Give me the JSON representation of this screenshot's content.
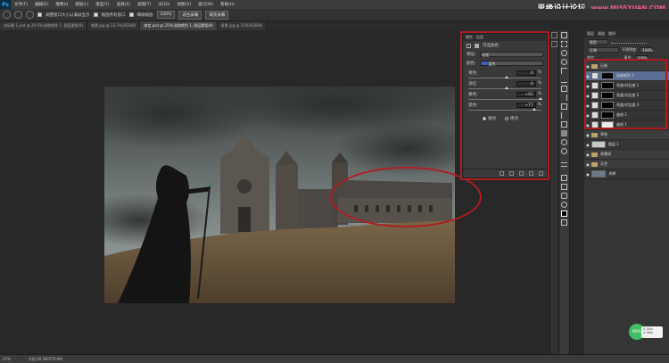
{
  "app": {
    "logo": "Ps",
    "accent": "#37a8f0"
  },
  "menubar": {
    "items": [
      "文件(F)",
      "编辑(E)",
      "图像(I)",
      "图层(L)",
      "类型(Y)",
      "选择(S)",
      "滤镜(T)",
      "3D(D)",
      "视图(V)",
      "窗口(W)",
      "帮助(H)"
    ]
  },
  "watermark": {
    "cn": "思缘设计论坛",
    "url": "www.MISSYUAN.COM"
  },
  "options": {
    "items": [
      "调整窗口大小以满屏显示",
      "缩放所有窗口",
      "细微缩放"
    ],
    "zoom_value": "100%",
    "fit_btn": "适合屏幕",
    "fill_btn": "填充屏幕"
  },
  "tabs": [
    "未标题-1.psd @ 29.5%(选取颜色 1, 图层蒙版/8)",
    "城堡.jpg @ 33.3%(RGB/8)",
    "修女.psd @ 25%(选取颜色 1, 图层蒙版/8)",
    "背景.jpg @ 25%(RGB/8)"
  ],
  "properties": {
    "tab1": "属性",
    "tab2": "信息",
    "title": "可选颜色",
    "preset_label": "预设:",
    "preset_value": "自定",
    "color_label": "颜色:",
    "color_value": "蓝色",
    "sliders": [
      {
        "label": "青色:",
        "value": "0",
        "unit": "%",
        "pos": 0.5
      },
      {
        "label": "洋红:",
        "value": "0",
        "unit": "%",
        "pos": 0.5
      },
      {
        "label": "黄色:",
        "value": "+92",
        "unit": "%",
        "pos": 0.96
      },
      {
        "label": "黑色:",
        "value": "+77",
        "unit": "%",
        "pos": 0.88
      }
    ],
    "radio_relative": "相对",
    "radio_absolute": "绝对"
  },
  "layers": {
    "tab1": "图层",
    "tab2": "通道",
    "tab3": "路径",
    "kind": "类型",
    "blend": "正常",
    "opacity_label": "不透明度:",
    "opacity_value": "100%",
    "lock_label": "锁定:",
    "fill_label": "填充:",
    "fill_value": "100%",
    "items": [
      {
        "name": "压制",
        "type": "group"
      },
      {
        "name": "选取颜色 1",
        "type": "adj",
        "selected": true
      },
      {
        "name": "亮度/对比度 1",
        "type": "adj"
      },
      {
        "name": "亮度/对比度 2",
        "type": "adj"
      },
      {
        "name": "亮度/对比度 3",
        "type": "adj"
      },
      {
        "name": "曲线 2",
        "type": "adj"
      },
      {
        "name": "曲线 1",
        "type": "adj"
      },
      {
        "name": "草地",
        "type": "group"
      },
      {
        "name": "图层 1",
        "type": "layer"
      },
      {
        "name": "背景树",
        "type": "group"
      },
      {
        "name": "天空",
        "type": "group"
      },
      {
        "name": "背景",
        "type": "layer"
      }
    ]
  },
  "status": {
    "zoom": "25%",
    "doc": "文档:26.5M/279.8M"
  },
  "speed": {
    "percent": "69%",
    "up": "0.1K/s",
    "down": "1.3K/s"
  }
}
